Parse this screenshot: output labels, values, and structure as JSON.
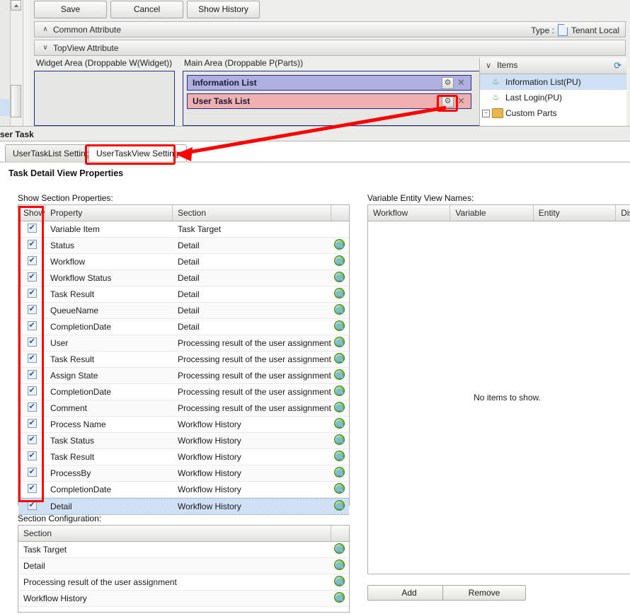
{
  "top_panel": {
    "toolbar": {
      "save": "Save",
      "cancel": "Cancel",
      "show_history": "Show History"
    },
    "sections": [
      {
        "caret": "∧",
        "label": "Common Attribute"
      },
      {
        "caret": "∨",
        "label": "TopView Attribute"
      }
    ],
    "type_label": "Type :",
    "type_value": "Tenant Local",
    "widget_area_label": "Widget Area (Droppable W(Widget))",
    "main_area_label": "Main Area (Droppable P(Parts))",
    "parts": [
      {
        "label": "Information List",
        "color": "#b0b0e0",
        "gear": "⚙",
        "close": "✕"
      },
      {
        "label": "User Task List",
        "color": "#efb0b0",
        "gear": "⚙",
        "close": "✕"
      }
    ],
    "items_panel": {
      "caret": "∨",
      "title": "Items",
      "refresh_icon": "refresh-icon",
      "entries": [
        {
          "label": "Information List(PU)",
          "icon": "puzzle-piece-icon",
          "selected": true
        },
        {
          "label": "Last Login(PU)",
          "icon": "puzzle-piece-icon",
          "selected": false
        },
        {
          "label": "Custom Parts",
          "icon": "folder-icon",
          "selected": false,
          "expander": "−"
        }
      ]
    }
  },
  "window_title": "ser Task",
  "tabs": [
    {
      "label": "UserTaskList Setting",
      "active": false
    },
    {
      "label": "UserTaskView Setting",
      "active": true
    }
  ],
  "page_title": "Task Detail View Properties",
  "show_section": {
    "caption": "Show Section Properties:",
    "columns": [
      "Show",
      "Property",
      "Section",
      ""
    ],
    "rows": [
      {
        "show": true,
        "property": "Variable Item",
        "section": "Task Target",
        "globe": false
      },
      {
        "show": true,
        "property": "Status",
        "section": "Detail",
        "globe": true
      },
      {
        "show": true,
        "property": "Workflow",
        "section": "Detail",
        "globe": true
      },
      {
        "show": true,
        "property": "Workflow Status",
        "section": "Detail",
        "globe": true
      },
      {
        "show": true,
        "property": "Task Result",
        "section": "Detail",
        "globe": true
      },
      {
        "show": true,
        "property": "QueueName",
        "section": "Detail",
        "globe": true
      },
      {
        "show": true,
        "property": "CompletionDate",
        "section": "Detail",
        "globe": true
      },
      {
        "show": true,
        "property": "User",
        "section": "Processing result of the user assignment",
        "globe": true
      },
      {
        "show": true,
        "property": "Task Result",
        "section": "Processing result of the user assignment",
        "globe": true
      },
      {
        "show": true,
        "property": "Assign State",
        "section": "Processing result of the user assignment",
        "globe": true
      },
      {
        "show": true,
        "property": "CompletionDate",
        "section": "Processing result of the user assignment",
        "globe": true
      },
      {
        "show": true,
        "property": "Comment",
        "section": "Processing result of the user assignment",
        "globe": true
      },
      {
        "show": true,
        "property": "Process Name",
        "section": "Workflow History",
        "globe": true
      },
      {
        "show": true,
        "property": "Task Status",
        "section": "Workflow History",
        "globe": true
      },
      {
        "show": true,
        "property": "Task Result",
        "section": "Workflow History",
        "globe": true
      },
      {
        "show": true,
        "property": "ProcessBy",
        "section": "Workflow History",
        "globe": true
      },
      {
        "show": true,
        "property": "CompletionDate",
        "section": "Workflow History",
        "globe": true
      },
      {
        "show": true,
        "property": "Detail",
        "section": "Workflow History",
        "globe": true,
        "selected": true
      }
    ]
  },
  "section_config": {
    "caption": "Section Configuration:",
    "columns": [
      "Section",
      ""
    ],
    "rows": [
      {
        "section": "Task Target",
        "globe": true
      },
      {
        "section": "Detail",
        "globe": true
      },
      {
        "section": "Processing result of the user assignment",
        "globe": true
      },
      {
        "section": "Workflow History",
        "globe": true
      }
    ]
  },
  "variable_entity": {
    "caption": "Variable Entity View Names:",
    "columns": [
      "Workflow",
      "Variable",
      "Entity",
      "Dis"
    ],
    "empty_message": "No items to show.",
    "buttons": {
      "add": "Add",
      "remove": "Remove"
    }
  },
  "annotations": {
    "accent_color": "#ff0000",
    "highlight_tab": "UserTaskView Setting",
    "highlight_gear": "User Task List gear button",
    "highlight_column": "Show"
  }
}
